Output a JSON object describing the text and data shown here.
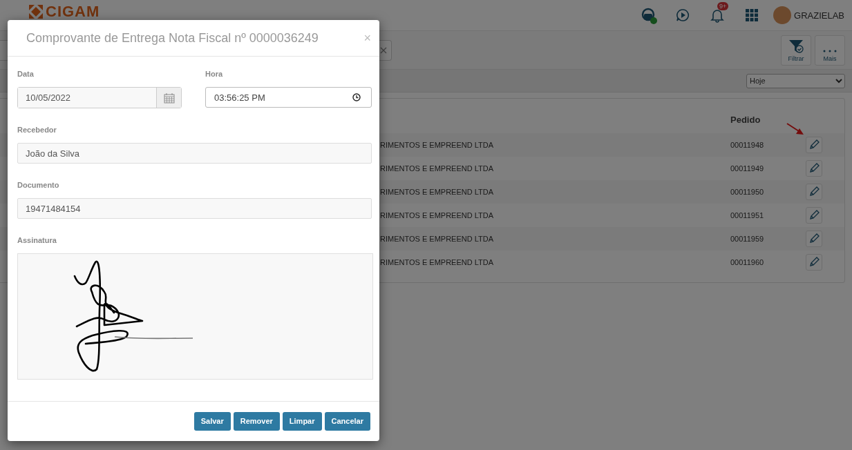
{
  "header": {
    "logo": "CIGAM",
    "notification_count": "9+",
    "support_online": true,
    "user": "GRAZIELAB"
  },
  "toolbar": {
    "buttons": [
      {
        "kind": "filter",
        "label": "Filtrar"
      },
      {
        "kind": "more",
        "label": "Mais"
      }
    ]
  },
  "period_select": {
    "value": "Hoje"
  },
  "table": {
    "columns": [
      "Pedido"
    ],
    "rows": [
      {
        "column_1": "RIMENTOS E EMPREEND LTDA",
        "pedido": "00011948"
      },
      {
        "column_1": "RIMENTOS E EMPREEND LTDA",
        "pedido": "00011949"
      },
      {
        "column_1": "RIMENTOS E EMPREEND LTDA",
        "pedido": "00011950"
      },
      {
        "column_1": "RIMENTOS E EMPREEND LTDA",
        "pedido": "00011951"
      },
      {
        "column_1": "RIMENTOS E EMPREEND LTDA",
        "pedido": "00011959"
      },
      {
        "column_1": "RIMENTOS E EMPREEND LTDA",
        "pedido": "00011960"
      }
    ]
  },
  "dialog": {
    "title": "Comprovante de Entrega Nota Fiscal nº 0000036249",
    "close": "×",
    "fields": [
      {
        "kind": "date",
        "label": "Data",
        "value": "10/05/2022"
      },
      {
        "kind": "time",
        "label": "Hora",
        "value": "03:56:25 PM"
      },
      {
        "kind": "text",
        "label": "Recebedor",
        "value": "João da Silva"
      },
      {
        "kind": "text",
        "label": "Documento",
        "value": "19471484154"
      },
      {
        "kind": "signature",
        "label": "Assinatura"
      }
    ],
    "buttons": [
      "Salvar",
      "Remover",
      "Limpar",
      "Cancelar"
    ]
  }
}
